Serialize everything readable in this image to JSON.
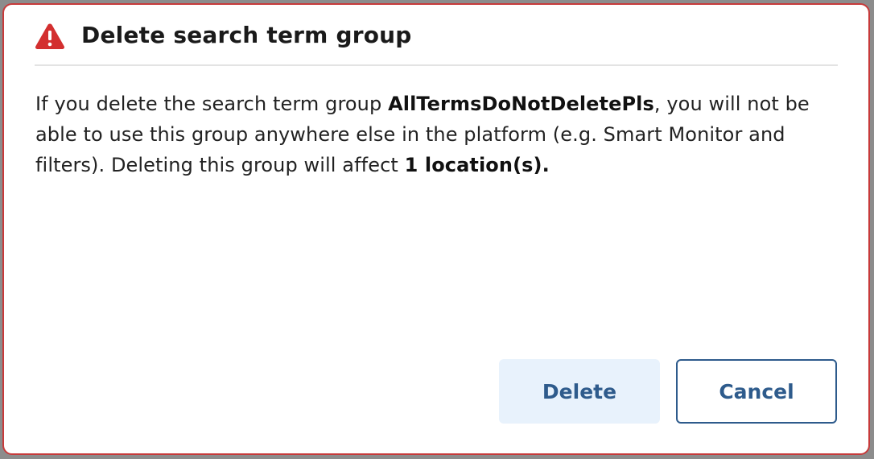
{
  "dialog": {
    "title": "Delete search term group",
    "title_icon": "warning-triangle-icon",
    "message": {
      "part1": "If you delete the search term group ",
      "group_name": "AllTermsDoNotDeletePls",
      "part2": ", you will not be able to use this group anywhere else in the platform (e.g. Smart Monitor and filters). Deleting this group will affect ",
      "affected": "1 location(s).",
      "part3": ""
    },
    "buttons": {
      "delete_label": "Delete",
      "cancel_label": "Cancel"
    }
  },
  "colors": {
    "danger": "#d32f2f",
    "dialog_border": "#c73a3a",
    "button_text": "#2e5b8c",
    "delete_bg": "#e8f2fc"
  }
}
